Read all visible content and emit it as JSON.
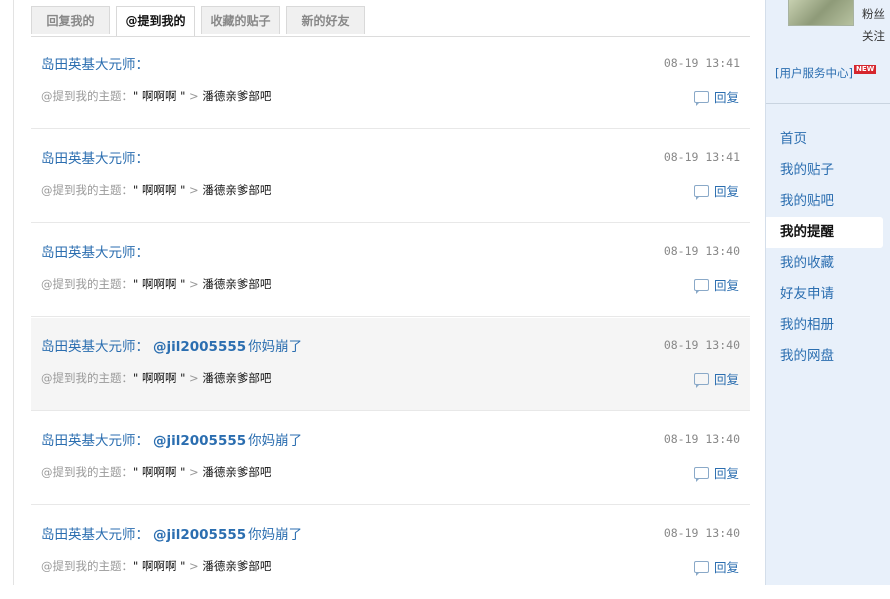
{
  "tabs": [
    {
      "label": "回复我的",
      "active": false
    },
    {
      "label": "@提到我的",
      "active": true
    },
    {
      "label": "收藏的贴子",
      "active": false
    },
    {
      "label": "新的好友",
      "active": false
    }
  ],
  "items": [
    {
      "author": "岛田英基大元师：",
      "mention": "",
      "message": "",
      "time": "08-19 13:41",
      "prefix": "@提到我的主题：",
      "topic": "\" 啊啊啊 \"",
      "sep": ">",
      "forum": "潘德亲爹部吧",
      "reply": "回复"
    },
    {
      "author": "岛田英基大元师：",
      "mention": "",
      "message": "",
      "time": "08-19 13:41",
      "prefix": "@提到我的主题：",
      "topic": "\" 啊啊啊 \"",
      "sep": ">",
      "forum": "潘德亲爹部吧",
      "reply": "回复"
    },
    {
      "author": "岛田英基大元师：",
      "mention": "",
      "message": "",
      "time": "08-19 13:40",
      "prefix": "@提到我的主题：",
      "topic": "\" 啊啊啊 \"",
      "sep": ">",
      "forum": "潘德亲爹部吧",
      "reply": "回复"
    },
    {
      "author": "岛田英基大元师：",
      "mention": "@jil2005555",
      "message": "你妈崩了",
      "time": "08-19 13:40",
      "prefix": "@提到我的主题：",
      "topic": "\" 啊啊啊 \"",
      "sep": ">",
      "forum": "潘德亲爹部吧",
      "reply": "回复"
    },
    {
      "author": "岛田英基大元师：",
      "mention": "@jil2005555",
      "message": "你妈崩了",
      "time": "08-19 13:40",
      "prefix": "@提到我的主题：",
      "topic": "\" 啊啊啊 \"",
      "sep": ">",
      "forum": "潘德亲爹部吧",
      "reply": "回复"
    },
    {
      "author": "岛田英基大元师：",
      "mention": "@jil2005555",
      "message": "你妈崩了",
      "time": "08-19 13:40",
      "prefix": "@提到我的主题：",
      "topic": "\" 啊啊啊 \"",
      "sep": ">",
      "forum": "潘德亲爹部吧",
      "reply": "回复"
    }
  ],
  "sidebar": {
    "fans_label": "粉丝",
    "follow_label": "关注",
    "service_label": "[用户服务中心]",
    "new_badge": "NEW",
    "nav": [
      {
        "label": "首页",
        "active": false
      },
      {
        "label": "我的贴子",
        "active": false
      },
      {
        "label": "我的贴吧",
        "active": false
      },
      {
        "label": "我的提醒",
        "active": true
      },
      {
        "label": "我的收藏",
        "active": false
      },
      {
        "label": "好友申请",
        "active": false
      },
      {
        "label": "我的相册",
        "active": false
      },
      {
        "label": "我的网盘",
        "active": false
      }
    ]
  },
  "colors": {
    "link": "#2b6eb0",
    "sidebar_bg": "#e8f0fa",
    "highlight_row": "#f5f5f5"
  }
}
